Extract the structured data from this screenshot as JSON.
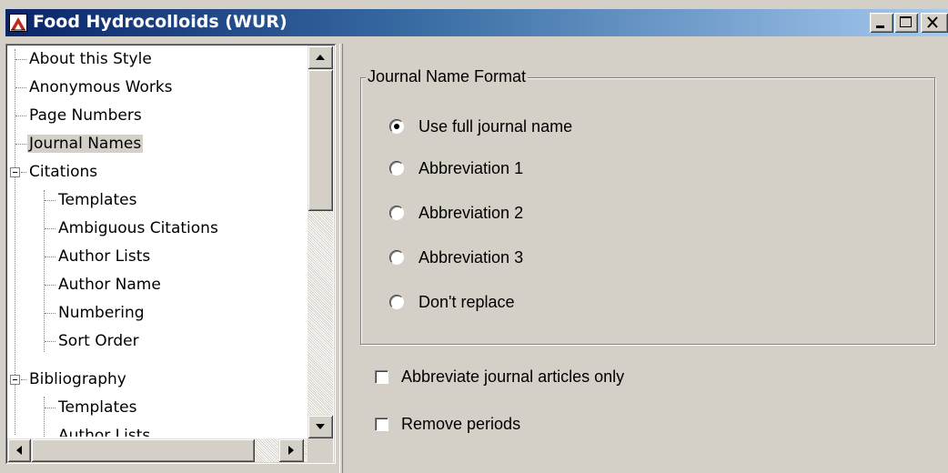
{
  "window": {
    "title": "Food Hydrocolloids (WUR)",
    "accent_color": "#0a246a",
    "background_color": "#d4d0c8"
  },
  "titlebar_buttons": {
    "minimize_icon": "minimize-icon",
    "maximize_icon": "maximize-icon",
    "close_icon": "close-icon"
  },
  "tree": {
    "items": [
      {
        "label": "About this Style"
      },
      {
        "label": "Anonymous Works"
      },
      {
        "label": "Page Numbers"
      },
      {
        "label": "Journal Names",
        "selected": true
      },
      {
        "label": "Citations",
        "expanded": true
      },
      {
        "label": "Templates"
      },
      {
        "label": "Ambiguous Citations"
      },
      {
        "label": "Author Lists"
      },
      {
        "label": "Author Name"
      },
      {
        "label": "Numbering"
      },
      {
        "label": "Sort Order"
      },
      {
        "label": "Bibliography",
        "expanded": true
      },
      {
        "label": "Templates"
      },
      {
        "label": "Author Lists"
      }
    ]
  },
  "journal_name_format": {
    "legend": "Journal Name Format",
    "options": [
      {
        "label": "Use full journal name",
        "checked": true
      },
      {
        "label": "Abbreviation 1",
        "checked": false
      },
      {
        "label": "Abbreviation 2",
        "checked": false
      },
      {
        "label": "Abbreviation 3",
        "checked": false
      },
      {
        "label": "Don't replace",
        "checked": false
      }
    ]
  },
  "options": {
    "abbreviate_articles_only": {
      "label": "Abbreviate journal articles only",
      "checked": false
    },
    "remove_periods": {
      "label": "Remove periods",
      "checked": false
    }
  }
}
